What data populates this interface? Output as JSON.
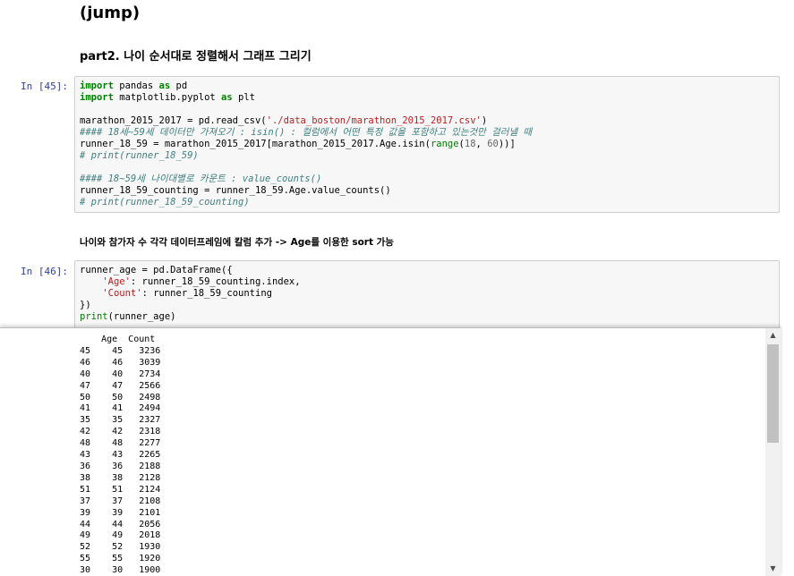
{
  "md_jump": "(jump)",
  "md_part2": "part2. 나이 순서대로 정렬해서 그래프 그리기",
  "cell45": {
    "prompt": "In [45]:",
    "lines": [
      [
        {
          "t": "import",
          "c": "kw"
        },
        {
          "t": " pandas "
        },
        {
          "t": "as",
          "c": "kw"
        },
        {
          "t": " pd"
        }
      ],
      [
        {
          "t": "import",
          "c": "kw"
        },
        {
          "t": " matplotlib.pyplot "
        },
        {
          "t": "as",
          "c": "kw"
        },
        {
          "t": " plt"
        }
      ],
      [],
      [
        {
          "t": "marathon_2015_2017 = pd.read_csv("
        },
        {
          "t": "'./data_boston/marathon_2015_2017.csv'",
          "c": "str"
        },
        {
          "t": ")"
        }
      ],
      [
        {
          "t": "#### 18세~59세 데이터만 가져오기 : isin() : 컬럼에서 어떤 특정 값을 포함하고 있는것만 걸러낼 때",
          "c": "cm"
        }
      ],
      [
        {
          "t": "runner_18_59 = marathon_2015_2017[marathon_2015_2017.Age.isin("
        },
        {
          "t": "range",
          "c": "bi"
        },
        {
          "t": "("
        },
        {
          "t": "18",
          "c": "num"
        },
        {
          "t": ", "
        },
        {
          "t": "60",
          "c": "num"
        },
        {
          "t": "))]"
        }
      ],
      [
        {
          "t": "# print(runner_18_59)",
          "c": "cm"
        }
      ],
      [],
      [
        {
          "t": "#### 18~59세 나이대별로 카운트 : value_counts()",
          "c": "cm"
        }
      ],
      [
        {
          "t": "runner_18_59_counting = runner_18_59.Age.value_counts()"
        }
      ],
      [
        {
          "t": "# print(runner_18_59_counting)",
          "c": "cm"
        }
      ]
    ]
  },
  "md_desc": "나이와 참가자 수 각각 데이터프레임에 칼럼 추가 -> Age를 이용한 sort 가능",
  "cell46": {
    "prompt": "In [46]:",
    "lines": [
      [
        {
          "t": "runner_age = pd.DataFrame({"
        }
      ],
      [
        {
          "t": "    "
        },
        {
          "t": "'Age'",
          "c": "str"
        },
        {
          "t": ": runner_18_59_counting.index,"
        }
      ],
      [
        {
          "t": "    "
        },
        {
          "t": "'Count'",
          "c": "str"
        },
        {
          "t": ": runner_18_59_counting"
        }
      ],
      [
        {
          "t": "})"
        }
      ],
      [
        {
          "t": "print",
          "c": "bi"
        },
        {
          "t": "(runner_age)"
        }
      ]
    ]
  },
  "output": {
    "header": "    Age  Count",
    "rows": [
      [
        "45",
        "45",
        "3236"
      ],
      [
        "46",
        "46",
        "3039"
      ],
      [
        "40",
        "40",
        "2734"
      ],
      [
        "47",
        "47",
        "2566"
      ],
      [
        "50",
        "50",
        "2498"
      ],
      [
        "41",
        "41",
        "2494"
      ],
      [
        "35",
        "35",
        "2327"
      ],
      [
        "42",
        "42",
        "2318"
      ],
      [
        "48",
        "48",
        "2277"
      ],
      [
        "43",
        "43",
        "2265"
      ],
      [
        "36",
        "36",
        "2188"
      ],
      [
        "38",
        "38",
        "2128"
      ],
      [
        "51",
        "51",
        "2124"
      ],
      [
        "37",
        "37",
        "2108"
      ],
      [
        "39",
        "39",
        "2101"
      ],
      [
        "44",
        "44",
        "2056"
      ],
      [
        "49",
        "49",
        "2018"
      ],
      [
        "52",
        "52",
        "1930"
      ],
      [
        "55",
        "55",
        "1920"
      ],
      [
        "30",
        "30",
        "1900"
      ]
    ]
  },
  "icons": {
    "scroll_up": "scroll-up-arrow-icon",
    "scroll_down": "scroll-down-arrow-icon"
  },
  "colors": {
    "prompt": "#303f9f",
    "keyword": "#008000",
    "string": "#ba2121",
    "comment": "#408080"
  }
}
